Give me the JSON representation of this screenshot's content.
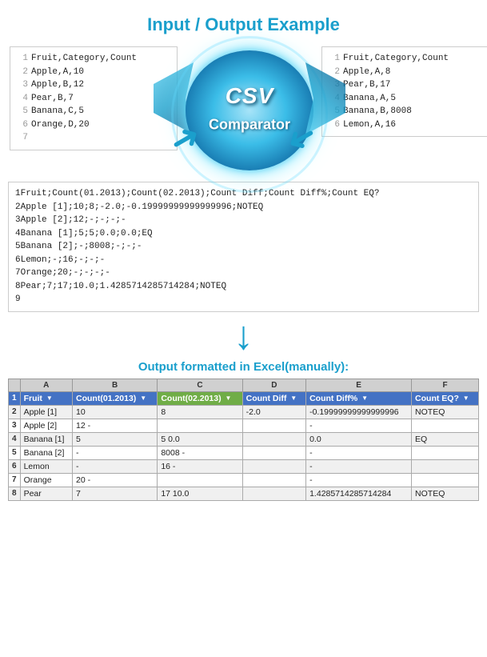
{
  "title": "Input / Output Example",
  "input1": {
    "lines": [
      {
        "num": "1",
        "content": "Fruit,Category,Count"
      },
      {
        "num": "2",
        "content": "Apple,A,10"
      },
      {
        "num": "3",
        "content": "Apple,B,12"
      },
      {
        "num": "4",
        "content": "Pear,B,7"
      },
      {
        "num": "5",
        "content": "Banana,C,5"
      },
      {
        "num": "6",
        "content": "Orange,D,20"
      },
      {
        "num": "7",
        "content": ""
      }
    ]
  },
  "input2": {
    "lines": [
      {
        "num": "1",
        "content": "Fruit,Category,Count"
      },
      {
        "num": "2",
        "content": "Apple,A,8"
      },
      {
        "num": "3",
        "content": "Pear,B,17"
      },
      {
        "num": "4",
        "content": "Banana,A,5"
      },
      {
        "num": "5",
        "content": "Banana,B,8008"
      },
      {
        "num": "6",
        "content": "Lemon,A,16"
      }
    ]
  },
  "logo": {
    "text_csv": "CSV",
    "text_comparator": "Comparator"
  },
  "output": {
    "lines": [
      {
        "num": "1",
        "content": "Fruit;Count(01.2013);Count(02.2013);Count Diff;Count Diff%;Count EQ?"
      },
      {
        "num": "2",
        "content": "Apple [1];10;8;-2.0;-0.19999999999999996;NOTEQ"
      },
      {
        "num": "3",
        "content": "Apple [2];12;-;-;-;-"
      },
      {
        "num": "4",
        "content": "Banana [1];5;5;0.0;0.0;EQ"
      },
      {
        "num": "5",
        "content": "Banana [2];-;8008;-;-;-"
      },
      {
        "num": "6",
        "content": "Lemon;-;16;-;-;-"
      },
      {
        "num": "7",
        "content": "Orange;20;-;-;-;-"
      },
      {
        "num": "8",
        "content": "Pear;7;17;10.0;1.4285714285714284;NOTEQ"
      },
      {
        "num": "9",
        "content": ""
      }
    ]
  },
  "excel_title": "Output formatted in Excel(manually):",
  "excel": {
    "col_headers": [
      "",
      "A",
      "B",
      "C",
      "D",
      "E",
      "F"
    ],
    "header_row": {
      "num": "1",
      "cells": [
        "Fruit",
        "Count(01.2013)",
        "Count(02.2013)",
        "Count Diff",
        "Count Diff%",
        "Count EQ?"
      ]
    },
    "data_rows": [
      {
        "num": "2",
        "cells": [
          "Apple [1]",
          "10",
          "8",
          "-2.0",
          "-0.19999999999999996",
          "NOTEQ"
        ]
      },
      {
        "num": "3",
        "cells": [
          "Apple [2]",
          "12 -",
          "",
          "",
          "-",
          ""
        ]
      },
      {
        "num": "4",
        "cells": [
          "Banana [1]",
          "5",
          "5 0.0",
          "",
          "0.0",
          "EQ"
        ]
      },
      {
        "num": "5",
        "cells": [
          "Banana [2]",
          "-",
          "8008 -",
          "",
          "-",
          ""
        ]
      },
      {
        "num": "6",
        "cells": [
          "Lemon",
          "-",
          "16 -",
          "",
          "-",
          ""
        ]
      },
      {
        "num": "7",
        "cells": [
          "Orange",
          "20 -",
          "",
          "",
          "-",
          ""
        ]
      },
      {
        "num": "8",
        "cells": [
          "Pear",
          "7",
          "17 10.0",
          "",
          "1.4285714285714284",
          "NOTEQ"
        ]
      }
    ]
  }
}
